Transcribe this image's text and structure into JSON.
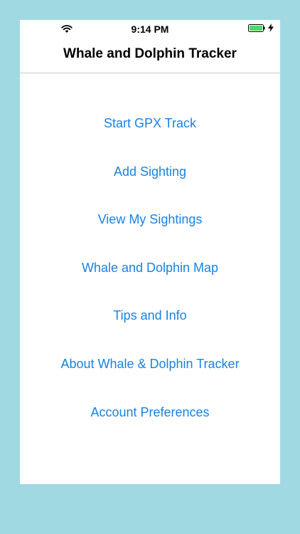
{
  "status_bar": {
    "time": "9:14 PM",
    "wifi_icon": "wifi-icon",
    "battery_icon": "battery-icon",
    "charging_icon": "bolt-icon",
    "battery_level": 1.0,
    "battery_color": "#4cd964"
  },
  "nav": {
    "title": "Whale and Dolphin Tracker"
  },
  "menu": {
    "start_gpx_track": "Start GPX Track",
    "add_sighting": "Add Sighting",
    "view_my_sightings": "View My Sightings",
    "whale_dolphin_map": "Whale and Dolphin Map",
    "tips_and_info": "Tips and Info",
    "about": "About Whale & Dolphin Tracker",
    "account_preferences": "Account Preferences"
  },
  "colors": {
    "background": "#a0d9e1",
    "link": "#1a82e2"
  }
}
